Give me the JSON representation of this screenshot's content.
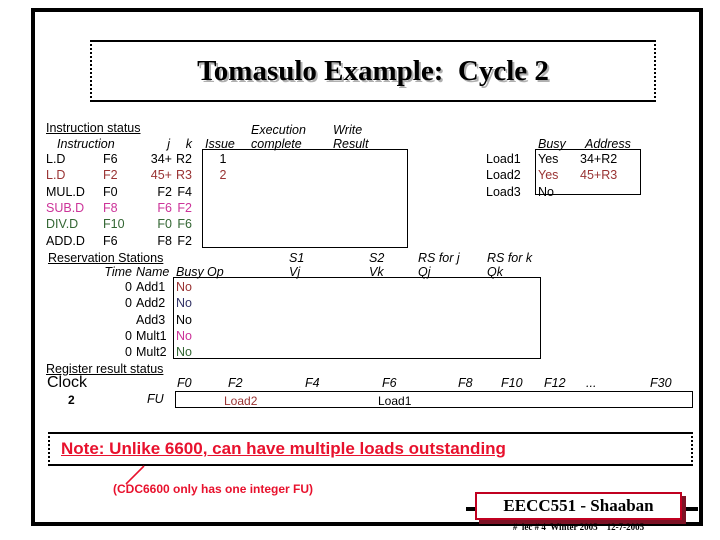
{
  "slide": {
    "title": "Tomasulo Example:  Cycle 2"
  },
  "instruction_status": {
    "section_label": "Instruction status",
    "headers": {
      "instruction": "Instruction",
      "j": "j",
      "k": "k",
      "issue": "Issue",
      "execution_line1": "Execution",
      "execution_line2": "complete",
      "write_line1": "Write",
      "write_line2": "Result"
    },
    "rows": [
      {
        "instruction": "L.D",
        "dest": "F6",
        "j": "34+",
        "k": "R2",
        "issue": "1",
        "exec": "",
        "write": "",
        "color": "c-black"
      },
      {
        "instruction": "L.D",
        "dest": "F2",
        "j": "45+",
        "k": "R3",
        "issue": "2",
        "exec": "",
        "write": "",
        "color": "c-red"
      },
      {
        "instruction": "MUL.D",
        "dest": "F0",
        "j": "F2",
        "k": "F4",
        "issue": "",
        "exec": "",
        "write": "",
        "color": "c-black"
      },
      {
        "instruction": "SUB.D",
        "dest": "F8",
        "j": "F6",
        "k": "F2",
        "issue": "",
        "exec": "",
        "write": "",
        "color": "c-mag"
      },
      {
        "instruction": "DIV.D",
        "dest": "F10",
        "j": "F0",
        "k": "F6",
        "issue": "",
        "exec": "",
        "write": "",
        "color": "c-green"
      },
      {
        "instruction": "ADD.D",
        "dest": "F6",
        "j": "F8",
        "k": "F2",
        "issue": "",
        "exec": "",
        "write": "",
        "color": "c-black"
      }
    ]
  },
  "load_buffers": {
    "headers": {
      "busy": "Busy",
      "address": "Address"
    },
    "rows": [
      {
        "name": "Load1",
        "busy": "Yes",
        "address": "34+R2",
        "color": "c-black"
      },
      {
        "name": "Load2",
        "busy": "Yes",
        "address": "45+R3",
        "color": "c-red"
      },
      {
        "name": "Load3",
        "busy": "No",
        "address": "",
        "color": "c-black"
      }
    ]
  },
  "reservation_stations": {
    "section_label": "Reservation Stations",
    "headers": {
      "time": "Time",
      "name": "Name",
      "busy": "Busy",
      "op": "Op",
      "s1": "S1",
      "vj": "Vj",
      "s2": "S2",
      "vk": "Vk",
      "rs_for_j": "RS for j",
      "qj": "Qj",
      "rs_for_k": "RS for k",
      "qk": "Qk"
    },
    "rows": [
      {
        "time": "0",
        "name": "Add1",
        "busy": "No",
        "op": "",
        "vj": "",
        "vk": "",
        "qj": "",
        "qk": "",
        "color": "c-red"
      },
      {
        "time": "0",
        "name": "Add2",
        "busy": "No",
        "op": "",
        "vj": "",
        "vk": "",
        "qj": "",
        "qk": "",
        "color": "c-navy"
      },
      {
        "time": "",
        "name": "Add3",
        "busy": "No",
        "op": "",
        "vj": "",
        "vk": "",
        "qj": "",
        "qk": "",
        "color": "c-black"
      },
      {
        "time": "0",
        "name": "Mult1",
        "busy": "No",
        "op": "",
        "vj": "",
        "vk": "",
        "qj": "",
        "qk": "",
        "color": "c-mag"
      },
      {
        "time": "0",
        "name": "Mult2",
        "busy": "No",
        "op": "",
        "vj": "",
        "vk": "",
        "qj": "",
        "qk": "",
        "color": "c-green"
      }
    ]
  },
  "register_result_status": {
    "section_label": "Register result status",
    "clock_label": "Clock",
    "clock_value": "2",
    "fu_label": "FU",
    "registers": [
      "F0",
      "F2",
      "F4",
      "F6",
      "F8",
      "F10",
      "F12",
      "...",
      "F30"
    ],
    "fu_entries": [
      {
        "register": "F2",
        "value": "Load2",
        "color": "c-red"
      },
      {
        "register": "F6",
        "value": "Load1",
        "color": "c-black"
      }
    ]
  },
  "note": {
    "main": "Note: Unlike 6600, can have multiple loads outstanding",
    "sub": "(CDC6600 only has one integer FU)"
  },
  "footer": {
    "course": "EECC551 - Shaaban",
    "detail": "#  lec # 4  Winter 2005    12-7-2005"
  },
  "colors": {
    "note_red": "#e8112d",
    "instr_red": "#993333",
    "instr_magenta": "#cc3399",
    "instr_green": "#336633",
    "instr_navy": "#333366",
    "footer_border": "#c00020",
    "footer_shadow": "#7d1225"
  }
}
